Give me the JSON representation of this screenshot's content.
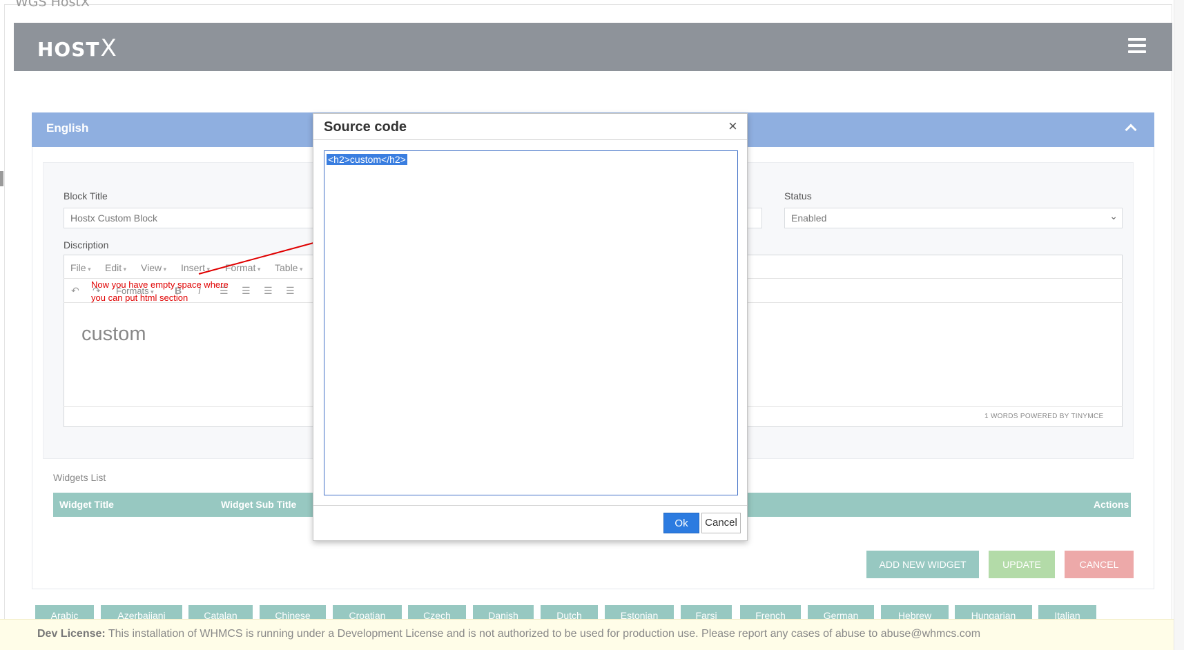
{
  "page": {
    "title": "WGS HostX"
  },
  "header": {
    "logo_text": "HOST",
    "logo_x": "X"
  },
  "panel": {
    "title": "English"
  },
  "form": {
    "block_title_label": "Block Title",
    "block_title_value": "Hostx Custom Block",
    "status_label": "Status",
    "status_value": "Enabled",
    "description_label": "Discription"
  },
  "editor": {
    "menu": [
      "File",
      "Edit",
      "View",
      "Insert",
      "Format",
      "Table"
    ],
    "formats_label": "Formats",
    "content_heading": "custom",
    "status_text": "1 WORDS POWERED BY TINYMCE"
  },
  "annotation": {
    "text": "Now you have empty space where you can put html section"
  },
  "widgets": {
    "label": "Widgets List",
    "columns": [
      "Widget Title",
      "Widget Sub Title",
      "Actions"
    ]
  },
  "actions": {
    "add_widget": "ADD NEW WIDGET",
    "update": "UPDATE",
    "cancel": "CANCEL"
  },
  "languages": [
    "Arabic",
    "Azerbaijani",
    "Catalan",
    "Chinese",
    "Croatian",
    "Czech",
    "Danish",
    "Dutch",
    "Estonian",
    "Farsi",
    "French",
    "German",
    "Hebrew",
    "Hungarian",
    "Italian"
  ],
  "license": {
    "label": "Dev License:",
    "text": "This installation of WHMCS is running under a Development License and is not authorized to be used for production use. Please report any cases of abuse to abuse@whmcs.com"
  },
  "modal": {
    "title": "Source code",
    "close": "×",
    "source": "<h2>custom</h2>",
    "ok": "Ok",
    "cancel": "Cancel"
  },
  "colors": {
    "header_bg": "#8e939a",
    "panel_head": "#8fafe0",
    "table_head": "#97c8c1",
    "add_btn": "#97c8c1",
    "update_btn": "#b3dba8",
    "cancel_btn": "#eda9a9",
    "ok_btn": "#2c7be0",
    "annotation": "#e00000"
  },
  "icons": [
    "menu-hamburger-icon",
    "chevron-up-icon",
    "undo-icon",
    "redo-icon",
    "bold-icon",
    "italic-icon",
    "align-left-icon",
    "align-center-icon",
    "align-right-icon",
    "align-justify-icon",
    "close-icon"
  ]
}
